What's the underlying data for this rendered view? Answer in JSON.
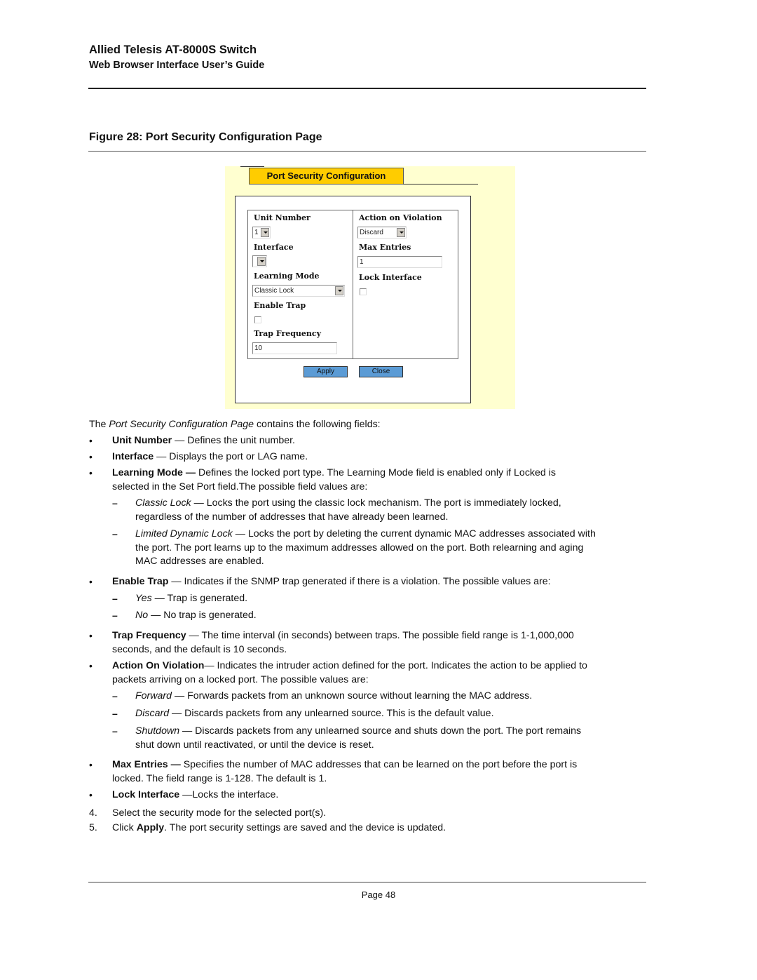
{
  "header": {
    "title": "Allied Telesis AT-8000S Switch",
    "subtitle": "Web Browser Interface User’s Guide"
  },
  "figure": {
    "caption": "Figure 28:  Port Security Configuration Page"
  },
  "screenshot": {
    "tab_label": "Port Security Configuration",
    "colors": {
      "background": "#ffffd0",
      "tab": "#ffcc00",
      "button": "#5b9bd5"
    },
    "left_column": {
      "unit_number": {
        "label": "Unit Number",
        "value": "1"
      },
      "interface": {
        "label": "Interface",
        "value": ""
      },
      "learning_mode": {
        "label": "Learning Mode",
        "value": "Classic Lock"
      },
      "enable_trap": {
        "label": "Enable Trap",
        "checked": false
      },
      "trap_frequency": {
        "label": "Trap Frequency",
        "value": "10"
      }
    },
    "right_column": {
      "action_on_violation": {
        "label": "Action on Violation",
        "value": "Discard"
      },
      "max_entries": {
        "label": "Max Entries",
        "value": "1"
      },
      "lock_interface": {
        "label": "Lock Interface",
        "checked": false
      }
    },
    "buttons": {
      "apply": "Apply",
      "close": "Close"
    }
  },
  "body": {
    "intro": {
      "pre": "The ",
      "em": "Port Security Configuration Page",
      "post": " contains the following fields:"
    },
    "bullet": "•",
    "dash": "–",
    "fields": {
      "unit_number": {
        "term": "Unit Number",
        "desc": " — Defines the unit number."
      },
      "interface": {
        "term": "Interface",
        "desc": " — Displays the port or LAG name."
      },
      "learning_mode": {
        "term": "Learning Mode —",
        "desc_line1": " Defines the locked port type. The Learning Mode field is enabled only if Locked is",
        "desc_line2": "selected in the Set Port field.The possible field values are:",
        "options": [
          {
            "name": "Classic Lock",
            "line1": " — Locks the port using the classic lock mechanism. The port is immediately locked,",
            "line2": "regardless of the number of addresses that have already been learned."
          },
          {
            "name": "Limited Dynamic Lock",
            "line1": " — Locks the port by deleting the current dynamic MAC addresses associated with",
            "line2": "the port. The port learns up to the maximum addresses allowed on the port. Both relearning and aging",
            "line3": "MAC addresses are enabled."
          }
        ]
      },
      "enable_trap": {
        "term": "Enable Trap",
        "desc": " — Indicates if the SNMP trap generated if there is a violation. The possible values are:",
        "options": [
          {
            "name": "Yes",
            "desc": " — Trap is generated."
          },
          {
            "name": "No",
            "desc": " — No trap is generated."
          }
        ]
      },
      "trap_frequency": {
        "term": "Trap Frequency",
        "desc_line1": " — The time interval (in seconds) between traps. The possible field range is 1-1,000,000",
        "desc_line2": "seconds, and the default is 10 seconds."
      },
      "action_on_violation": {
        "term": "Action On Violation",
        "desc_line1": "— Indicates the intruder action defined for the port. Indicates the action to be applied to",
        "desc_line2": "packets arriving on a locked port. The possible values are:",
        "options": [
          {
            "name": "Forward",
            "line1": " — Forwards packets from an unknown source without learning the MAC address."
          },
          {
            "name": "Discard",
            "line1": " — Discards packets from any unlearned source. This is the default value."
          },
          {
            "name": "Shutdown",
            "line1": " — Discards packets from any unlearned source and shuts down the port. The port remains",
            "line2": "shut down until reactivated, or until the device is reset."
          }
        ]
      },
      "max_entries": {
        "term": "Max Entries —",
        "desc_line1": " Specifies the number of MAC addresses that can be learned on the port before the port is",
        "desc_line2": "locked. The field range is 1-128. The default is 1."
      },
      "lock_interface": {
        "term": "Lock Interface",
        "desc": " —Locks the interface."
      }
    },
    "steps": [
      {
        "num": "4.",
        "text": "Select the security mode for the selected port(s)."
      },
      {
        "num": "5.",
        "pre": "Click ",
        "strong": "Apply",
        "post": ". The port security settings are saved and the device is updated."
      }
    ]
  },
  "footer": {
    "page": "Page 48"
  }
}
